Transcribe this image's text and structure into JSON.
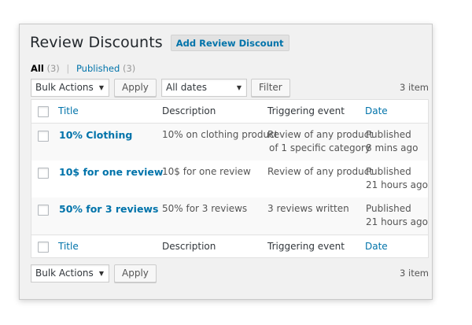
{
  "header": {
    "title": "Review Discounts",
    "add_button": "Add Review Discount"
  },
  "filters": {
    "all_label": "All",
    "all_count": "(3)",
    "published_label": "Published",
    "published_count": "(3)",
    "separator": "|"
  },
  "toolbar_top": {
    "bulk_actions": "Bulk Actions",
    "apply": "Apply",
    "dates": "All dates",
    "filter": "Filter",
    "items_count": "3 item"
  },
  "toolbar_bottom": {
    "bulk_actions": "Bulk Actions",
    "apply": "Apply",
    "items_count": "3 item"
  },
  "table": {
    "columns": {
      "title": "Title",
      "description": "Description",
      "triggering_event": "Triggering event",
      "date": "Date"
    },
    "rows": [
      {
        "title": "10% Clothing",
        "description": "10% on clothing product",
        "event_line1": "Review of any product",
        "event_line2": "of 1 specific category",
        "status": "Published",
        "time": "8 mins ago"
      },
      {
        "title": "10$ for one review",
        "description": "10$ for one review",
        "event_line1": "Review of any product",
        "event_line2": "",
        "status": "Published",
        "time": "21 hours ago"
      },
      {
        "title": "50% for 3 reviews",
        "description": "50% for 3 reviews",
        "event_line1": "3 reviews written",
        "event_line2": "",
        "status": "Published",
        "time": "21 hours ago"
      }
    ]
  },
  "colors": {
    "link": "#0073aa",
    "panel_background": "#f1f1f1"
  }
}
